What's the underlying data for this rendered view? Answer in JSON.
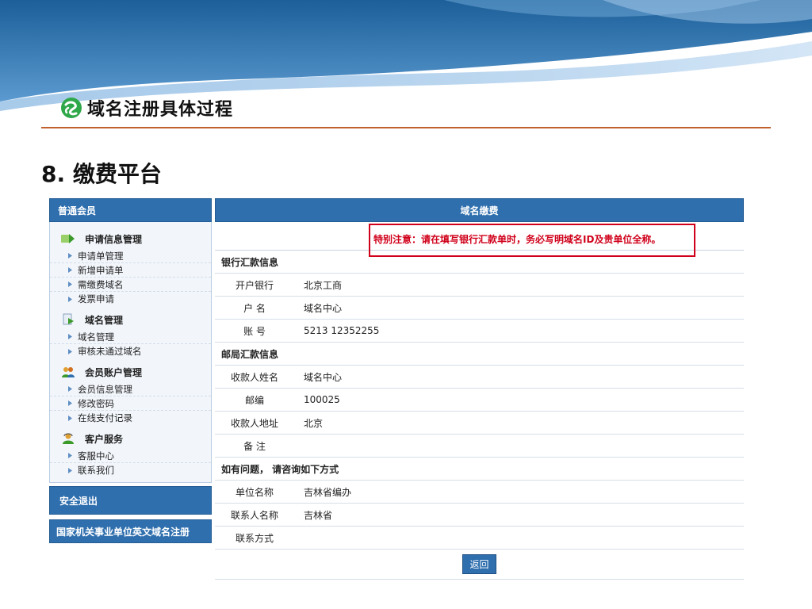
{
  "slide": {
    "title": "域名注册具体过程",
    "section_heading": "8. 缴费平台"
  },
  "colors": {
    "header_blue": "#2f6fae",
    "notice_red": "#d0001a",
    "accent_rule": "#c0602a"
  },
  "sidebar": {
    "header": "普通会员",
    "groups": [
      {
        "title": "申请信息管理",
        "icon": "arrow-right-icon",
        "items": [
          "申请单管理",
          "新增申请单",
          "需缴费域名",
          "发票申请"
        ]
      },
      {
        "title": "域名管理",
        "icon": "document-arrow-icon",
        "items": [
          "域名管理",
          "审核未通过域名"
        ]
      },
      {
        "title": "会员账户管理",
        "icon": "users-icon",
        "items": [
          "会员信息管理",
          "修改密码",
          "在线支付记录"
        ]
      },
      {
        "title": "客户服务",
        "icon": "support-person-icon",
        "items": [
          "客服中心",
          "联系我们"
        ]
      }
    ],
    "logout": "安全退出",
    "footer": "国家机关事业单位英文域名注册"
  },
  "main": {
    "header": "域名缴费",
    "notice": "特别注意：请在填写银行汇款单时，务必写明域名ID及贵单位全称。",
    "bank_section": "银行汇款信息",
    "bank": [
      {
        "label": "开户银行",
        "value": "北京工商"
      },
      {
        "label": "户 名",
        "value": "域名中心"
      },
      {
        "label": "账 号",
        "value": "5213 12352255"
      }
    ],
    "post_section": "邮局汇款信息",
    "post": [
      {
        "label": "收款人姓名",
        "value": "域名中心"
      },
      {
        "label": "邮编",
        "value": "100025"
      },
      {
        "label": "收款人地址",
        "value": "北京"
      },
      {
        "label": "备 注",
        "value": ""
      }
    ],
    "contact_section": "如有问题， 请咨询如下方式",
    "contact": [
      {
        "label": "单位名称",
        "value": "吉林省编办"
      },
      {
        "label": "联系人名称",
        "value": "吉林省"
      },
      {
        "label": "联系方式",
        "value": ""
      }
    ],
    "back_button": "返回"
  }
}
